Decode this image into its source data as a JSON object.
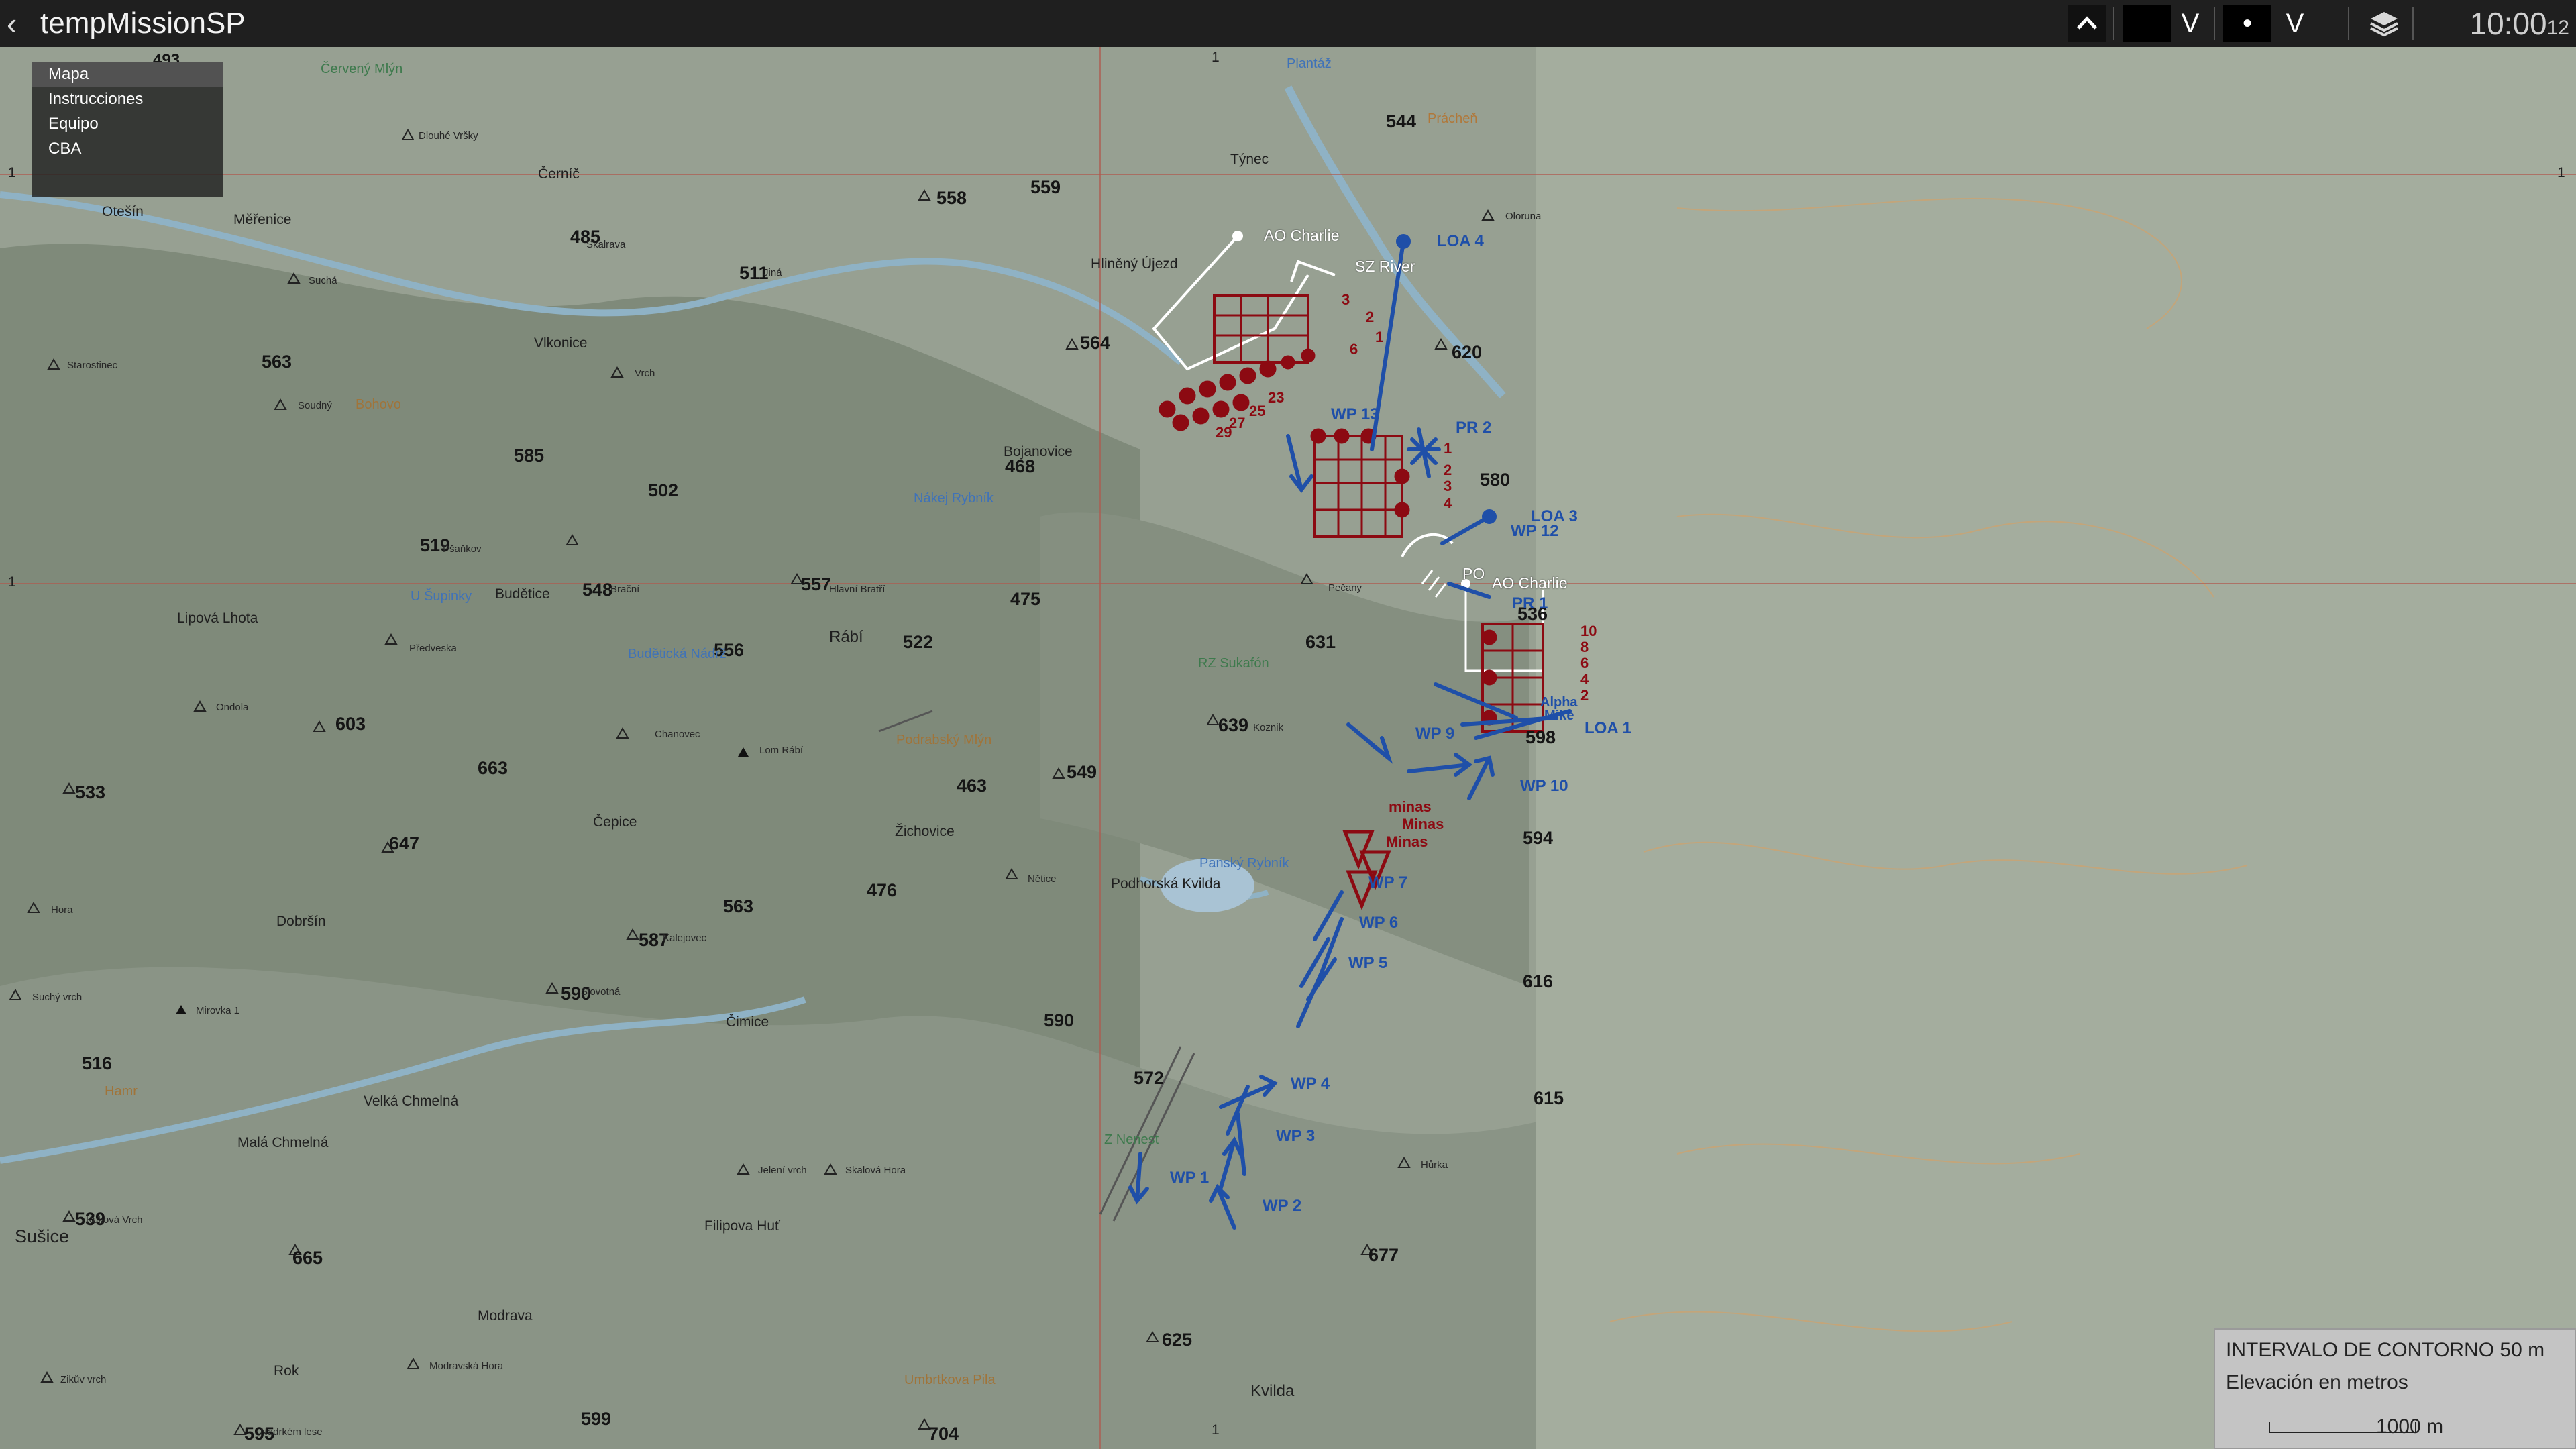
{
  "topbar": {
    "mission_title": "tempMissionSP",
    "time_main": "10:00",
    "time_seconds": "12",
    "controls": [
      {
        "name": "collapse-up-icon",
        "glyph": "^"
      },
      {
        "name": "v-toggle-1",
        "glyph": "V"
      },
      {
        "name": "dot-toggle",
        "glyph": "•"
      },
      {
        "name": "v-toggle-2",
        "glyph": "V"
      },
      {
        "name": "layers-icon",
        "glyph": "layers"
      }
    ]
  },
  "menu": {
    "items": [
      "Mapa",
      "Instrucciones",
      "Equipo",
      "CBA"
    ],
    "selected": "Mapa"
  },
  "map": {
    "grid_labels": [
      "493",
      "1",
      "1",
      "1",
      "1",
      "1"
    ],
    "towns": [
      "Otešín",
      "Měřenice",
      "Černíč",
      "Vlkonice",
      "Týnec",
      "Hliněný Újezd",
      "Bojanovice",
      "Budětice",
      "Lipová Lhota",
      "Rábí",
      "Čepice",
      "Dobršín",
      "Žichovice",
      "Podhorská Kvilda",
      "Čimice",
      "Velká Chmelná",
      "Malá Chmelná",
      "Sušice",
      "Filipova Huť",
      "Modrava",
      "Rok",
      "Kvilda"
    ],
    "elevations": [
      "544",
      "559",
      "558",
      "485",
      "511",
      "563",
      "585",
      "502",
      "468",
      "564",
      "620",
      "580",
      "519",
      "548",
      "557",
      "475",
      "556",
      "522",
      "631",
      "536",
      "603",
      "663",
      "639",
      "598",
      "533",
      "549",
      "463",
      "647",
      "476",
      "594",
      "563",
      "587",
      "590",
      "590",
      "616",
      "572",
      "615",
      "516",
      "539",
      "665",
      "677",
      "625",
      "595",
      "599",
      "704"
    ],
    "hills": [
      "Dlouhé Vršky",
      "Skalrava",
      "Jiná",
      "Suchá",
      "Starostinec",
      "Soudný",
      "Vrch",
      "Pšaňkov",
      "Brační",
      "Hlavní Bratří",
      "Předveska",
      "Ondola",
      "Chanovec",
      "Lom Rábí",
      "Pečany",
      "Koznik",
      "Nětice",
      "Hora",
      "Suchý vrch",
      "Mirovka 1",
      "Kalejovec",
      "Slovotná",
      "Oloruna",
      "Jelení vrch",
      "Skalová Hora",
      "Kuková Vrch",
      "Hůrka",
      "Zikův vrch",
      "Nadrkém lese",
      "Modravská Hora"
    ],
    "water": [
      "Plantáž",
      "Nákej Rybník",
      "U Šupinky",
      "Budětická Nádrž",
      "Panský Rybník",
      "Prácheň"
    ],
    "forest": [
      "Červený Mlýn",
      "Bohovo",
      "Podrabský Mlýn",
      "RZ Sukafón",
      "Z Nenest",
      "Umbrtkova Pila",
      "Hamr"
    ],
    "markers_blue": [
      "LOA 4",
      "WP 13",
      "PR 2",
      "LOA 3",
      "WP 12",
      "PR 1",
      "LOA 1",
      "WP 9",
      "WP 10",
      "WP 7",
      "WP 6",
      "WP 5",
      "WP 4",
      "WP 3",
      "WP 1",
      "WP 2",
      "Mike",
      "Alpha"
    ],
    "markers_white": [
      "AO Charlie",
      "SZ River",
      "AO Charlie",
      "PO"
    ],
    "markers_red": [
      "3",
      "2",
      "1",
      "6",
      "27",
      "29",
      "25",
      "23",
      "1",
      "2",
      "3",
      "4",
      "10",
      "8",
      "6",
      "4",
      "2",
      "minas",
      "Minas",
      "Minas"
    ]
  },
  "legend": {
    "contour_interval": "INTERVALO DE CONTORNO 50 m",
    "elevation_unit": "Elevación en metros",
    "scale_label": "1000 m"
  },
  "colors": {
    "topbar_bg": "#1f1f1f",
    "map_bg": "#8f9a8b",
    "blue_force": "#1f4fa8",
    "red_force": "#8c0a12",
    "menu_bg": "#1e1e1e",
    "legend_bg": "#c4c4c4"
  }
}
